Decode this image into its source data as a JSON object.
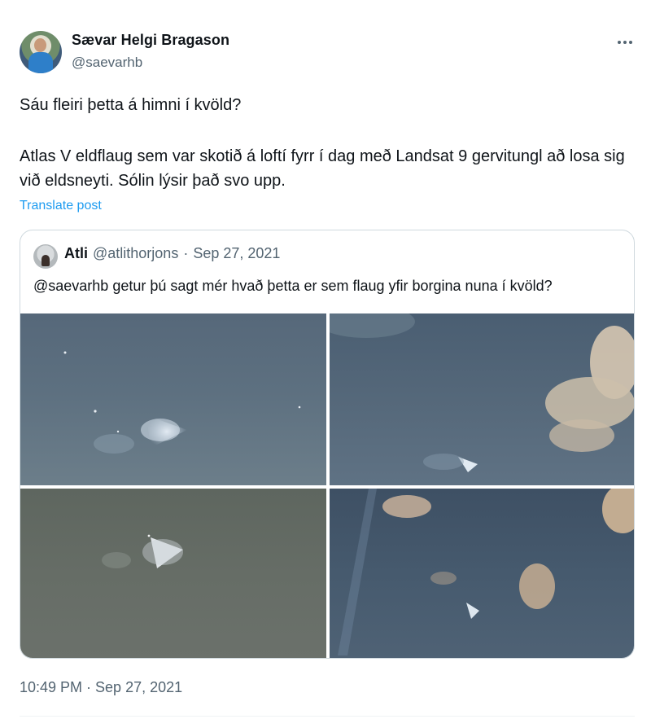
{
  "author": {
    "name": "Sævar Helgi Bragason",
    "handle": "@saevarhb"
  },
  "tweet": {
    "line1": "Sáu fleiri þetta á himni í kvöld?",
    "line2": "Atlas V eldflaug sem var skotið á loftí fyrr í dag með Landsat 9 gervitungl að losa sig við eldsneyti. Sólin lýsir það svo upp.",
    "translate": "Translate post",
    "timestamp": "10:49 PM · Sep 27, 2021"
  },
  "quote": {
    "name": "Atli",
    "handle": "@atlithorjons",
    "separator": "·",
    "date": "Sep 27, 2021",
    "text": "@saevarhb getur þú sagt mér hvað þetta er sem flaug yfir borgina nuna í kvöld?",
    "image_count": 4
  },
  "icons": {
    "more": "more-horizontal-icon"
  }
}
